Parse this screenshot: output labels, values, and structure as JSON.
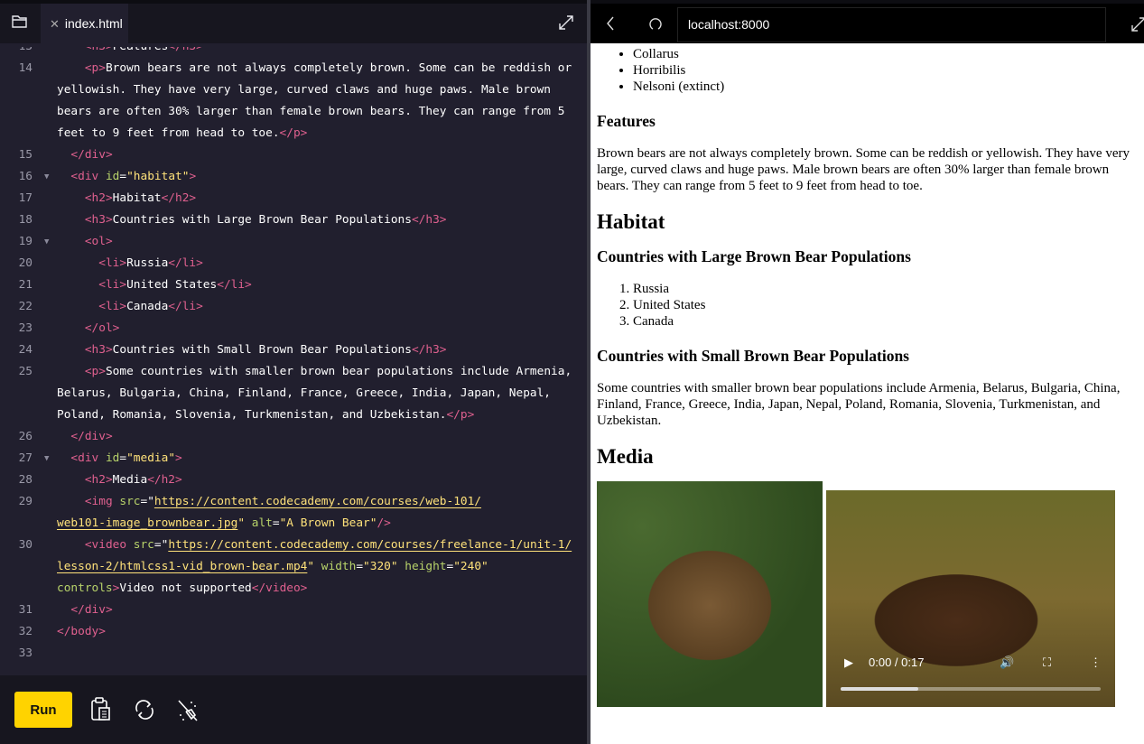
{
  "editor": {
    "tab_label": "index.html",
    "icons": {
      "files": "folder-icon",
      "close": "close-icon",
      "expand": "expand-icon"
    },
    "lines": [
      {
        "n": "13",
        "rows": [
          [
            [
              "t",
              "<h3>"
            ],
            [
              "x",
              "Features"
            ],
            [
              "t",
              "</h3>"
            ]
          ]
        ],
        "indent": "    "
      },
      {
        "n": "14",
        "indent": "    ",
        "rows": [
          [
            [
              "t",
              "<p>"
            ],
            [
              "x",
              "Brown bears are not always completely brown. Some can be reddish or"
            ]
          ],
          [
            [
              "x",
              "yellowish. They have very large, curved claws and huge paws. Male brown"
            ]
          ],
          [
            [
              "x",
              "bears are often 30% larger than female brown bears. They can range from 5"
            ]
          ],
          [
            [
              "x",
              "feet to 9 feet from head to toe."
            ],
            [
              "t",
              "</p>"
            ]
          ]
        ]
      },
      {
        "n": "15",
        "indent": "  ",
        "rows": [
          [
            [
              "t",
              "</div>"
            ]
          ]
        ]
      },
      {
        "n": "16",
        "indent": "  ",
        "fold": true,
        "rows": [
          [
            [
              "t",
              "<div "
            ],
            [
              "a",
              "id"
            ],
            [
              "x",
              "="
            ],
            [
              "s",
              "\"habitat\""
            ],
            [
              "t",
              ">"
            ]
          ]
        ]
      },
      {
        "n": "17",
        "indent": "    ",
        "rows": [
          [
            [
              "t",
              "<h2>"
            ],
            [
              "x",
              "Habitat"
            ],
            [
              "t",
              "</h2>"
            ]
          ]
        ]
      },
      {
        "n": "18",
        "indent": "    ",
        "rows": [
          [
            [
              "t",
              "<h3>"
            ],
            [
              "x",
              "Countries with Large Brown Bear Populations"
            ],
            [
              "t",
              "</h3>"
            ]
          ]
        ]
      },
      {
        "n": "19",
        "indent": "    ",
        "fold": true,
        "rows": [
          [
            [
              "t",
              "<ol>"
            ]
          ]
        ]
      },
      {
        "n": "20",
        "indent": "      ",
        "rows": [
          [
            [
              "t",
              "<li>"
            ],
            [
              "x",
              "Russia"
            ],
            [
              "t",
              "</li>"
            ]
          ]
        ]
      },
      {
        "n": "21",
        "indent": "      ",
        "rows": [
          [
            [
              "t",
              "<li>"
            ],
            [
              "x",
              "United States"
            ],
            [
              "t",
              "</li>"
            ]
          ]
        ]
      },
      {
        "n": "22",
        "indent": "      ",
        "rows": [
          [
            [
              "t",
              "<li>"
            ],
            [
              "x",
              "Canada"
            ],
            [
              "t",
              "</li>"
            ]
          ]
        ]
      },
      {
        "n": "23",
        "indent": "    ",
        "rows": [
          [
            [
              "t",
              "</ol>"
            ]
          ]
        ]
      },
      {
        "n": "24",
        "indent": "    ",
        "rows": [
          [
            [
              "t",
              "<h3>"
            ],
            [
              "x",
              "Countries with Small Brown Bear Populations"
            ],
            [
              "t",
              "</h3>"
            ]
          ]
        ]
      },
      {
        "n": "25",
        "indent": "    ",
        "rows": [
          [
            [
              "t",
              "<p>"
            ],
            [
              "x",
              "Some countries with smaller brown bear populations include Armenia,"
            ]
          ],
          [
            [
              "x",
              "Belarus, Bulgaria, China, Finland, France, Greece, India, Japan, Nepal,"
            ]
          ],
          [
            [
              "x",
              "Poland, Romania, Slovenia, Turkmenistan, and Uzbekistan."
            ],
            [
              "t",
              "</p>"
            ]
          ]
        ]
      },
      {
        "n": "26",
        "indent": "  ",
        "rows": [
          [
            [
              "t",
              "</div>"
            ]
          ]
        ]
      },
      {
        "n": "27",
        "indent": "  ",
        "fold": true,
        "rows": [
          [
            [
              "t",
              "<div "
            ],
            [
              "a",
              "id"
            ],
            [
              "x",
              "="
            ],
            [
              "s",
              "\"media\""
            ],
            [
              "t",
              ">"
            ]
          ]
        ]
      },
      {
        "n": "28",
        "indent": "    ",
        "rows": [
          [
            [
              "t",
              "<h2>"
            ],
            [
              "x",
              "Media"
            ],
            [
              "t",
              "</h2>"
            ]
          ]
        ]
      },
      {
        "n": "29",
        "indent": "    ",
        "rows": [
          [
            [
              "t",
              "<img "
            ],
            [
              "a",
              "src"
            ],
            [
              "x",
              "=\""
            ],
            [
              "su",
              "https://content.codecademy.com/courses/web-101/"
            ]
          ],
          [
            [
              "su",
              "web101-image_brownbear.jpg"
            ],
            [
              "s",
              "\" "
            ],
            [
              "a",
              "alt"
            ],
            [
              "x",
              "="
            ],
            [
              "s",
              "\"A Brown Bear\""
            ],
            [
              "t",
              "/>"
            ]
          ]
        ]
      },
      {
        "n": "30",
        "indent": "    ",
        "rows": [
          [
            [
              "t",
              "<video "
            ],
            [
              "a",
              "src"
            ],
            [
              "x",
              "=\""
            ],
            [
              "su",
              "https://content.codecademy.com/courses/freelance-1/unit-1/"
            ]
          ],
          [
            [
              "su",
              "lesson-2/htmlcss1-vid_brown-bear.mp4"
            ],
            [
              "s",
              "\" "
            ],
            [
              "a",
              "width"
            ],
            [
              "x",
              "="
            ],
            [
              "s",
              "\"320\" "
            ],
            [
              "a",
              "height"
            ],
            [
              "x",
              "="
            ],
            [
              "s",
              "\"240\""
            ]
          ],
          [
            [
              "a",
              "controls"
            ],
            [
              "t",
              ">"
            ],
            [
              "x",
              "Video not supported"
            ],
            [
              "t",
              "</video>"
            ]
          ]
        ]
      },
      {
        "n": "31",
        "indent": "  ",
        "rows": [
          [
            [
              "t",
              "</div>"
            ]
          ]
        ]
      },
      {
        "n": "32",
        "indent": "",
        "rows": [
          [
            [
              "t",
              "</body>"
            ]
          ]
        ]
      },
      {
        "n": "33",
        "indent": "",
        "rows": [
          []
        ]
      }
    ]
  },
  "toolbar": {
    "run_label": "Run",
    "icons": [
      "clipboard-icon",
      "refresh-icon",
      "clean-icon"
    ]
  },
  "browser": {
    "url": "localhost:8000",
    "icons": [
      "back-icon",
      "reload-icon",
      "expand-icon"
    ]
  },
  "page": {
    "subspecies": [
      "Collarus",
      "Horribilis",
      "Nelsoni (extinct)"
    ],
    "features_title": "Features",
    "features_text": "Brown bears are not always completely brown. Some can be reddish or yellowish. They have very large, curved claws and huge paws. Male brown bears are often 30% larger than female brown bears. They can range from 5 feet to 9 feet from head to toe.",
    "habitat_title": "Habitat",
    "large_title": "Countries with Large Brown Bear Populations",
    "large_list": [
      "Russia",
      "United States",
      "Canada"
    ],
    "small_title": "Countries with Small Brown Bear Populations",
    "small_text": "Some countries with smaller brown bear populations include Armenia, Belarus, Bulgaria, China, Finland, France, Greece, India, Japan, Nepal, Poland, Romania, Slovenia, Turkmenistan, and Uzbekistan.",
    "media_title": "Media",
    "video": {
      "time": "0:00 / 0:17",
      "progress": 0.3
    }
  }
}
